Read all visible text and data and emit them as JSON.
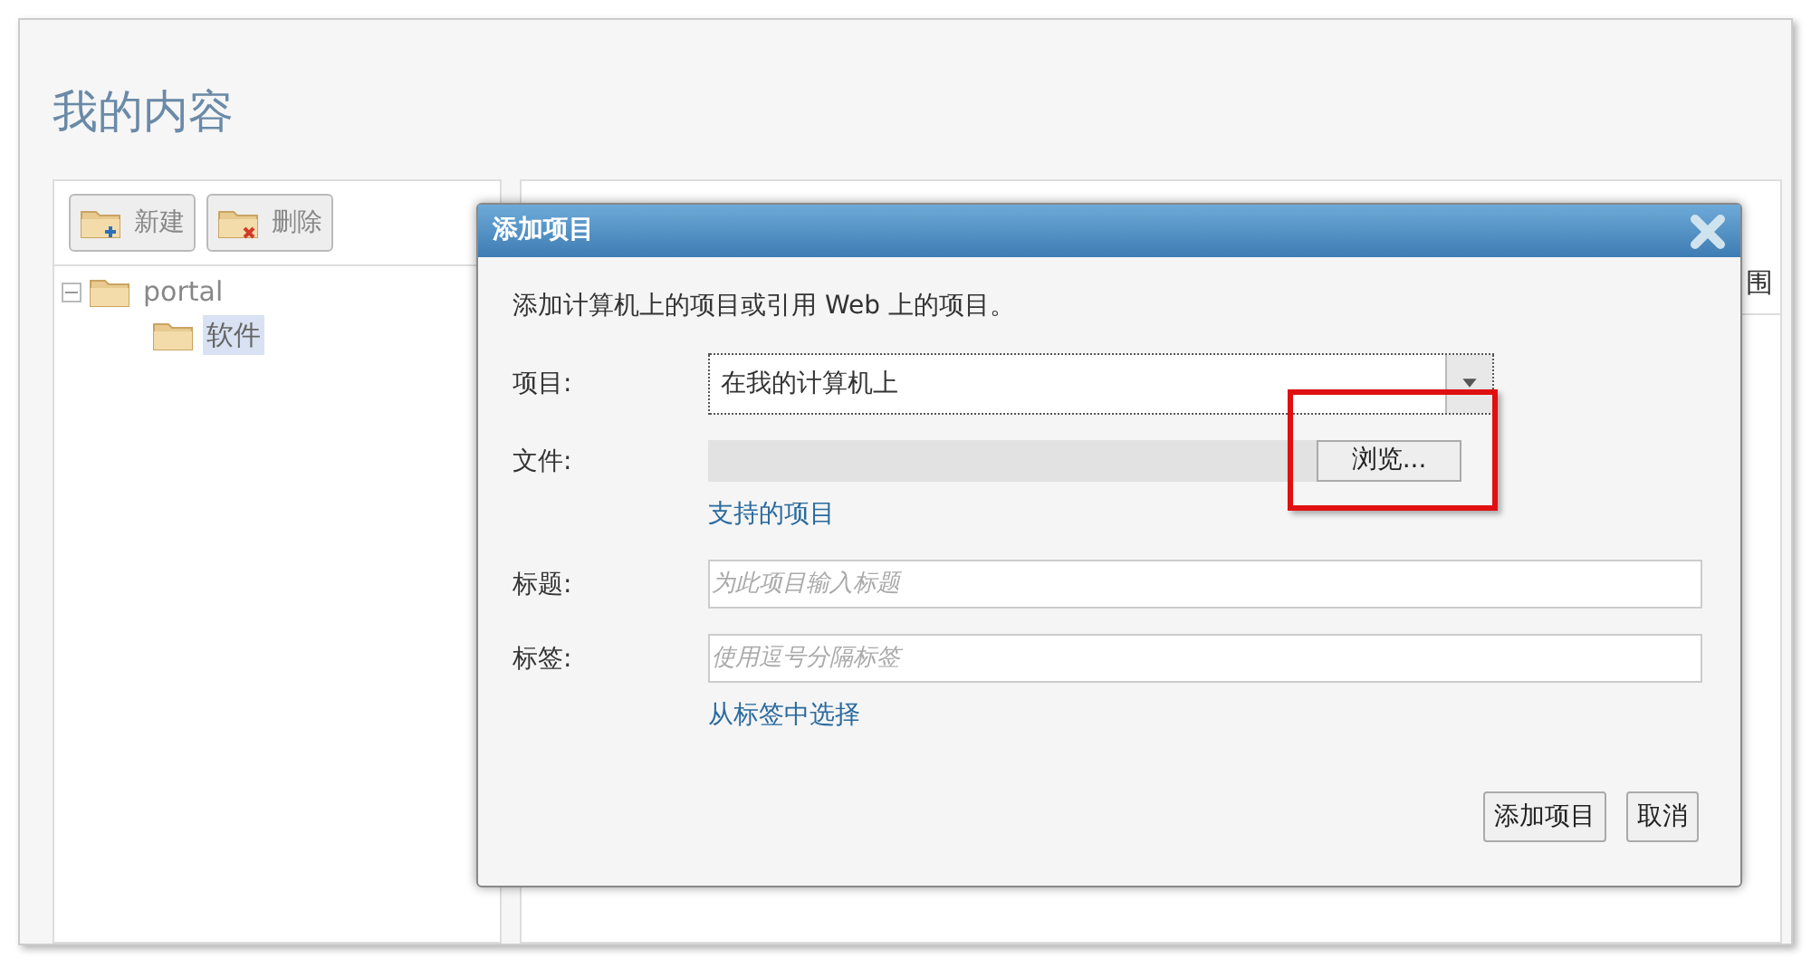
{
  "page": {
    "title": "我的内容"
  },
  "toolbar": [
    {
      "label": "新建",
      "kind": "new"
    },
    {
      "label": "删除",
      "kind": "delete"
    }
  ],
  "tree": [
    {
      "label": "portal",
      "expanded": true,
      "selected": false,
      "children": [
        {
          "label": "软件",
          "selected": true
        }
      ]
    }
  ],
  "content": {
    "column_header": "围"
  },
  "dialog": {
    "title": "添加项目",
    "intro": "添加计算机上的项目或引用 Web 上的项目。",
    "fields": [
      {
        "label": "项目:",
        "kind": "select",
        "value": "在我的计算机上"
      },
      {
        "label": "文件:",
        "kind": "file",
        "button": "浏览...",
        "link": "支持的项目"
      },
      {
        "label": "标题:",
        "kind": "text",
        "placeholder": "为此项目输入标题"
      },
      {
        "label": "标签:",
        "kind": "text",
        "placeholder": "使用逗号分隔标签",
        "link": "从标签中选择"
      }
    ],
    "buttons": [
      "添加项目",
      "取消"
    ]
  }
}
